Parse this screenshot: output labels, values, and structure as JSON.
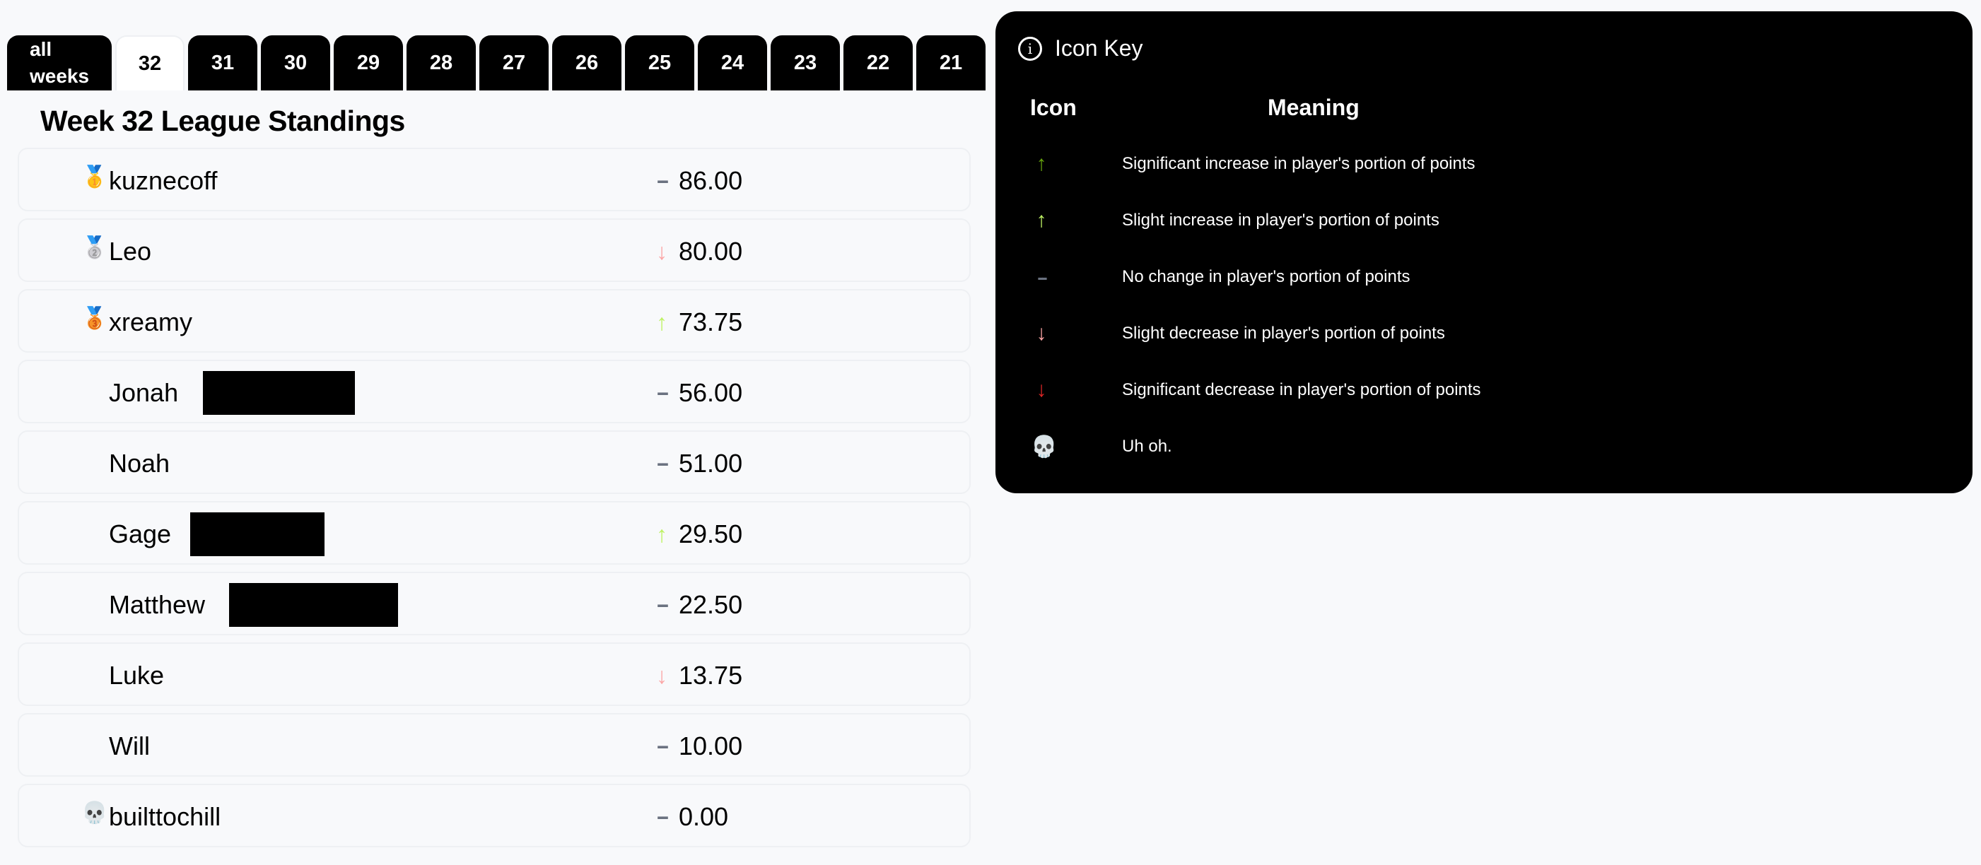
{
  "tabs": {
    "all_line1": "all",
    "all_line2": "weeks",
    "weeks": [
      "32",
      "31",
      "30",
      "29",
      "28",
      "27",
      "26",
      "25",
      "24",
      "23",
      "22",
      "21",
      ""
    ],
    "active": "32"
  },
  "title": "Week 32 League Standings",
  "colors": {
    "sig_up": "#65a30d",
    "slight_up": "#bef264",
    "none": "#6b7280",
    "slight_down": "#fca5a5",
    "sig_down": "#dc2626"
  },
  "standings": [
    {
      "medal": "🥇",
      "name": "kuznecoff",
      "trend": "none",
      "value": "86.00"
    },
    {
      "medal": "🥈",
      "name": "Leo",
      "trend": "slight_down",
      "value": "80.00"
    },
    {
      "medal": "🥉",
      "name": "xreamy",
      "trend": "slight_up",
      "value": "73.75"
    },
    {
      "medal": "",
      "name": "Jonah",
      "trend": "none",
      "value": "56.00",
      "redacted": true
    },
    {
      "medal": "",
      "name": "Noah",
      "trend": "none",
      "value": "51.00"
    },
    {
      "medal": "",
      "name": "Gage",
      "trend": "slight_up",
      "value": "29.50",
      "redacted": true
    },
    {
      "medal": "",
      "name": "Matthew",
      "trend": "none",
      "value": "22.50",
      "redacted": true
    },
    {
      "medal": "",
      "name": "Luke",
      "trend": "slight_down",
      "value": "13.75"
    },
    {
      "medal": "",
      "name": "Will",
      "trend": "none",
      "value": "10.00"
    },
    {
      "medal": "💀",
      "name": "builttochill",
      "trend": "none",
      "value": "0.00"
    }
  ],
  "icon_key": {
    "title": "Icon Key",
    "col_icon": "Icon",
    "col_meaning": "Meaning",
    "rows": [
      {
        "icon": "arrow-up-icon",
        "trend": "sig_up",
        "meaning": "Significant increase in player's portion of points"
      },
      {
        "icon": "arrow-up-icon",
        "trend": "slight_up",
        "meaning": "Slight increase in player's portion of points"
      },
      {
        "icon": "dashes-icon",
        "trend": "none",
        "meaning": "No change in player's portion of points"
      },
      {
        "icon": "arrow-down-icon",
        "trend": "slight_down",
        "meaning": "Slight decrease in player's portion of points"
      },
      {
        "icon": "arrow-down-icon",
        "trend": "sig_down",
        "meaning": "Significant decrease in player's portion of points"
      },
      {
        "icon": "skull-icon",
        "trend": "skull",
        "meaning": "Uh oh."
      }
    ]
  }
}
